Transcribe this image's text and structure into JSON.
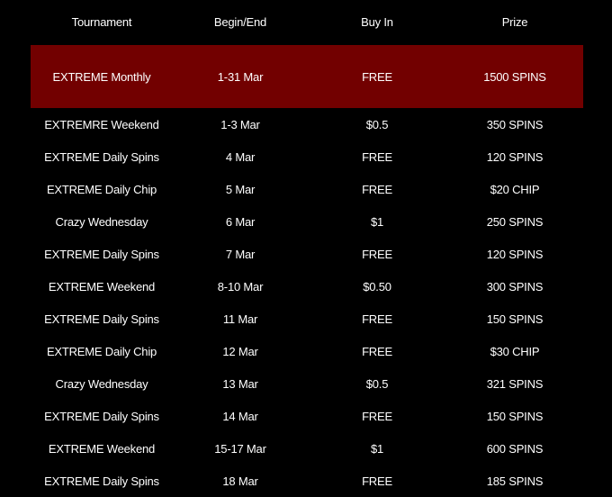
{
  "headers": {
    "tournament": "Tournament",
    "begin_end": "Begin/End",
    "buy_in": "Buy In",
    "prize": "Prize"
  },
  "colors": {
    "background": "#000000",
    "highlight_row": "#720000",
    "text": "#ffffff"
  },
  "rows": [
    {
      "tournament": "EXTREME Monthly",
      "dates": "1-31 Mar",
      "buy_in": "FREE",
      "prize": "1500 SPINS",
      "highlighted": true
    },
    {
      "tournament": "EXTREMRE Weekend",
      "dates": "1-3 Mar",
      "buy_in": "$0.5",
      "prize": "350 SPINS"
    },
    {
      "tournament": "EXTREME Daily Spins",
      "dates": "4 Mar",
      "buy_in": "FREE",
      "prize": "120 SPINS"
    },
    {
      "tournament": "EXTREME Daily Chip",
      "dates": "5 Mar",
      "buy_in": "FREE",
      "prize": "$20 CHIP"
    },
    {
      "tournament": "Crazy Wednesday",
      "dates": "6 Mar",
      "buy_in": "$1",
      "prize": "250 SPINS"
    },
    {
      "tournament": "EXTREME Daily Spins",
      "dates": "7 Mar",
      "buy_in": "FREE",
      "prize": "120 SPINS"
    },
    {
      "tournament": "EXTREME Weekend",
      "dates": "8-10 Mar",
      "buy_in": "$0.50",
      "prize": "300 SPINS"
    },
    {
      "tournament": "EXTREME Daily Spins",
      "dates": "11 Mar",
      "buy_in": "FREE",
      "prize": "150 SPINS"
    },
    {
      "tournament": "EXTREME Daily Chip",
      "dates": "12 Mar",
      "buy_in": "FREE",
      "prize": "$30 CHIP"
    },
    {
      "tournament": "Crazy Wednesday",
      "dates": "13 Mar",
      "buy_in": "$0.5",
      "prize": "321 SPINS"
    },
    {
      "tournament": "EXTREME Daily Spins",
      "dates": "14 Mar",
      "buy_in": "FREE",
      "prize": "150 SPINS"
    },
    {
      "tournament": "EXTREME Weekend",
      "dates": "15-17 Mar",
      "buy_in": "$1",
      "prize": "600 SPINS"
    },
    {
      "tournament": "EXTREME Daily Spins",
      "dates": "18 Mar",
      "buy_in": "FREE",
      "prize": "185 SPINS"
    }
  ]
}
